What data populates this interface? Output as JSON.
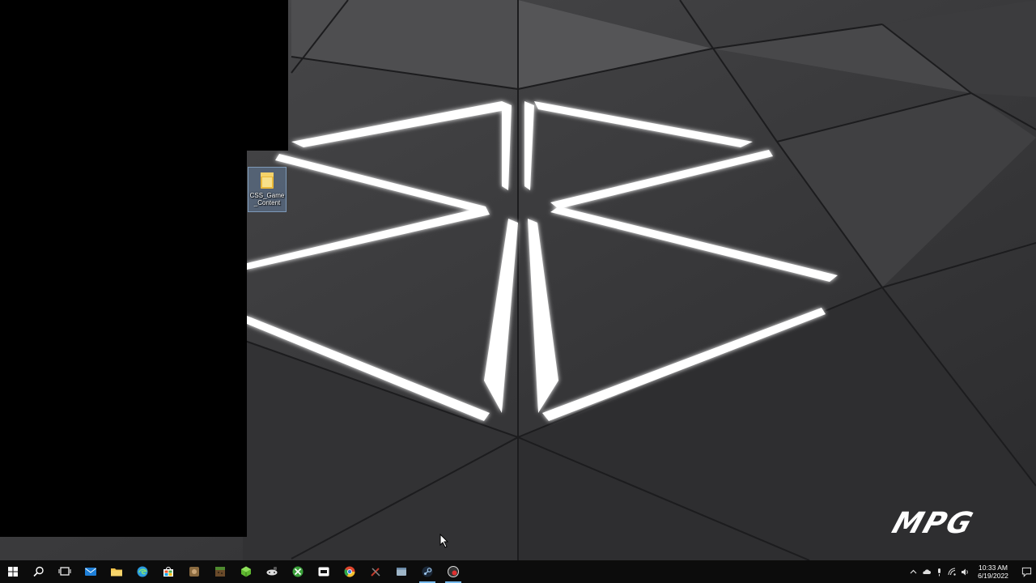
{
  "desktop": {
    "icons": [
      {
        "label": "CSS_Game_Content",
        "icon": "folder-icon"
      }
    ],
    "brand_logo": "MPG"
  },
  "taskbar": {
    "start": "windows-start-icon",
    "search": "search-icon",
    "task_view": "task-view-icon",
    "apps": [
      {
        "name": "mail",
        "icon": "mail-icon",
        "color": "#1e7fd8"
      },
      {
        "name": "file-explorer",
        "icon": "folder-icon",
        "color": "#f3c34a"
      },
      {
        "name": "edge",
        "icon": "edge-icon",
        "color": "#2a9be0"
      },
      {
        "name": "store",
        "icon": "store-icon",
        "color": "#4cae4f"
      },
      {
        "name": "game-app-1",
        "icon": "game-icon",
        "color": "#8a6a3f"
      },
      {
        "name": "minecraft",
        "icon": "minecraft-icon",
        "color": "#6a4a2a"
      },
      {
        "name": "game-app-2",
        "icon": "cube-icon",
        "color": "#5fb830"
      },
      {
        "name": "app-controller",
        "icon": "controller-icon",
        "color": "#dddddd"
      },
      {
        "name": "xbox",
        "icon": "xbox-icon",
        "color": "#3aa13a"
      },
      {
        "name": "app-square",
        "icon": "square-app-icon",
        "color": "#ffffff"
      },
      {
        "name": "chrome",
        "icon": "chrome-icon",
        "color": "#e0452c"
      },
      {
        "name": "app-tools",
        "icon": "tools-icon",
        "color": "#c0392b"
      },
      {
        "name": "app-window",
        "icon": "window-app-icon",
        "color": "#9fb6c8"
      },
      {
        "name": "steam",
        "icon": "steam-icon",
        "color": "#9ec8ee"
      },
      {
        "name": "app-recorder",
        "icon": "recorder-icon",
        "color": "#e03030"
      }
    ],
    "tray": {
      "icons": [
        "chevron-up-icon",
        "cloud-icon",
        "microphone-icon",
        "network-icon",
        "volume-icon"
      ],
      "time": "10:33 AM",
      "date": "6/19/2022"
    }
  }
}
